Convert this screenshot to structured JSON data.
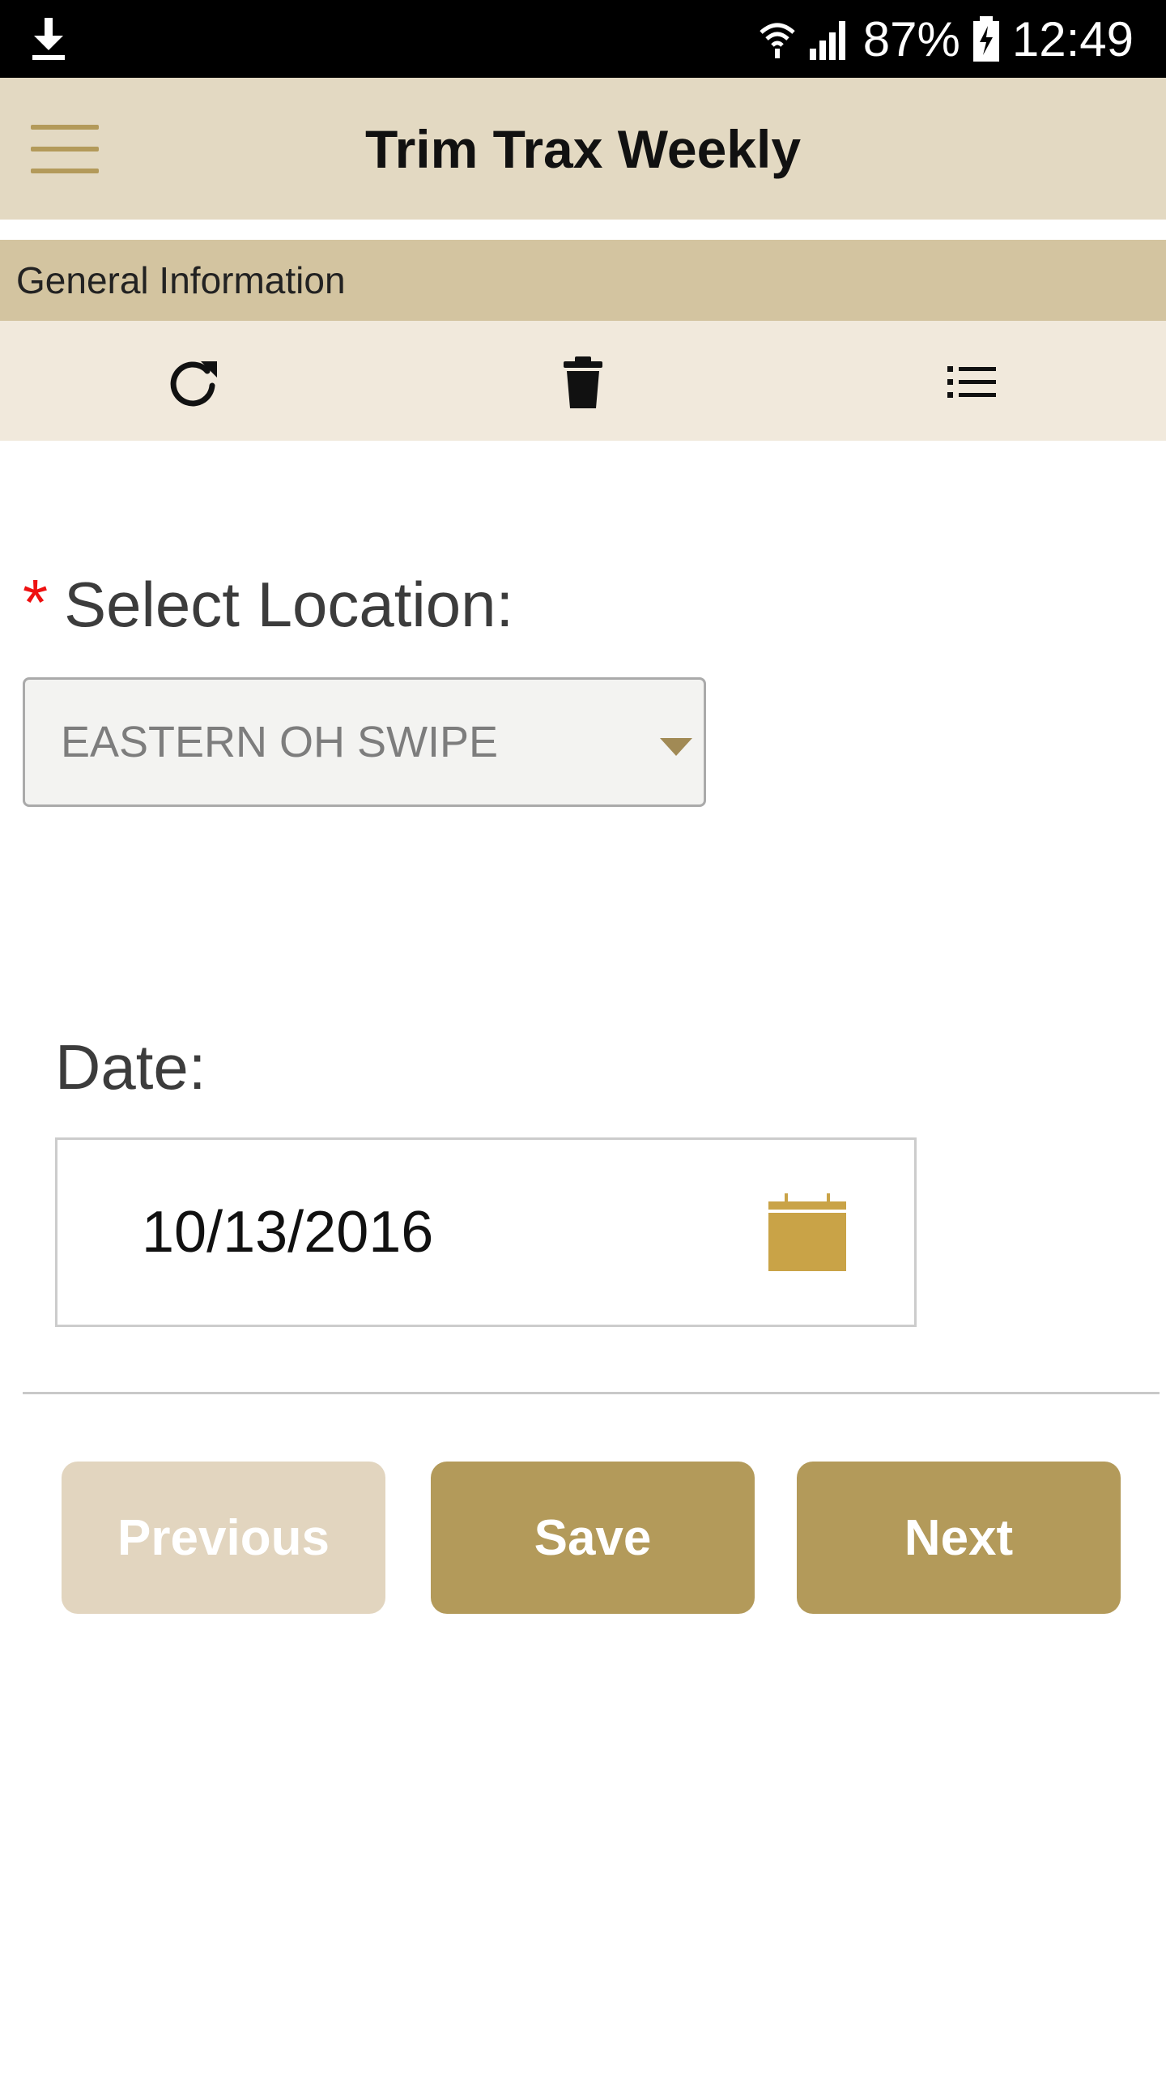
{
  "status_bar": {
    "battery": "87%",
    "time": "12:49",
    "icons": [
      "download-icon",
      "wifi-icon",
      "signal-icon",
      "battery-icon"
    ]
  },
  "header": {
    "title": "Trim Trax Weekly",
    "menu_icon": "hamburger-menu-icon"
  },
  "section": {
    "title": "General Information"
  },
  "toolbar": {
    "icons": [
      "refresh-icon",
      "trash-icon",
      "list-icon"
    ]
  },
  "location": {
    "required_mark": "*",
    "label": "Select Location:",
    "selected": "EASTERN OH SWIPE"
  },
  "date": {
    "label": "Date:",
    "value": "10/13/2016",
    "icon": "calendar-icon"
  },
  "buttons": {
    "previous": "Previous",
    "save": "Save",
    "next": "Next"
  },
  "colors": {
    "accent": "#b39a5a",
    "accent_disabled": "#e2d5bf",
    "header_bg": "#e3d9c2",
    "section_bg": "#d3c4a0",
    "toolbar_bg": "#f1e9dc",
    "calendar": "#c9a347",
    "required": "#ee1111"
  }
}
